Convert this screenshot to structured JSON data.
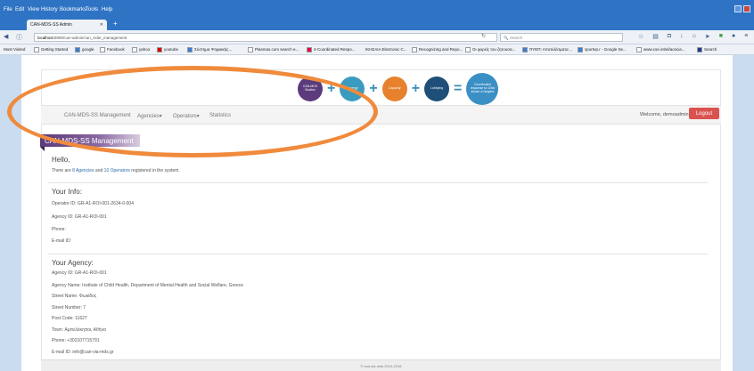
{
  "browser": {
    "menu": [
      "File",
      "Edit",
      "View",
      "History",
      "Bookmarks",
      "Tools",
      "Help"
    ],
    "tab_title": "CAN-MDS-SS Admin",
    "new_tab": "+",
    "url_host": "localhost",
    "url_path": ":8080/can-admin/can_ssite_management",
    "search_placeholder": "Search",
    "bookmarks": [
      "Most Visited",
      "Getting Started",
      "google",
      "Facebook",
      "yahoo",
      "youtube",
      "Σύστημα Ψηφιακής...",
      "Plasmas.com search e...",
      "4-Coordinated Respo...",
      "ΙΚΗΣΑΙΑ Electronic C...",
      "Recognizing and Repo...",
      "Οι φορείς του ζητουσα...",
      "ΠΥΕΠ: Αποτελέσματα ...",
      "sportep.r - Google Se...",
      "www.cse.int/el/acecia...",
      "Search"
    ]
  },
  "app": {
    "logos": [
      {
        "label": "CAN-MDS Studies",
        "color": "#5b3b7b"
      },
      {
        "label": "Synergy",
        "color": "#3a9bbf"
      },
      {
        "label": "Capacity",
        "color": "#e7812d"
      },
      {
        "label": "Lobbying",
        "color": "#1f4e79"
      },
      {
        "label": "Coordinated response to Child Abuse & Neglect",
        "color": "#3a8fc5"
      }
    ],
    "nav": {
      "brand": "CAN-MDS-SS Management",
      "agencies": "Agencies▾",
      "operators": "Operators▾",
      "statistics": "Statistics",
      "welcome": "Welcome, demoadmin",
      "logout": "Logout"
    },
    "banner": "CAN-MDS-SS Management",
    "hello": {
      "title": "Hello,",
      "text_pre": "There are ",
      "agencies_link": "8 Agencies",
      "text_mid": " and ",
      "operators_link": "10 Operators",
      "text_post": " registered in the system."
    },
    "your_info": {
      "title": "Your Info:",
      "operator_id": "Operator ID: GR-A1-ROI-001-2634-0-004",
      "agency_id": "Agency ID: GR-A1-ROI-001",
      "phone": "Phone:",
      "email": "E-mail ID:"
    },
    "your_agency": {
      "title": "Your Agency:",
      "agency_id": "Agency ID: GR-A1-ROI-001",
      "agency_name": "Agency Name: Institute of Child Health, Department of Mental Health and Social Welfare, Greece",
      "street_name": "Street Name: Φωκίδος",
      "street_number": "Street Number: 7",
      "post_code": "Post Code: 11627",
      "town": "Town: Αμπελόκηποι, Αθήνα",
      "phone": "Phone: +302107715791",
      "email": "E-mail ID: info@can-via-mds.gr"
    },
    "footer": "© can-via-mds 2014-2016"
  },
  "colors": {
    "browser_blue": "#2f74c4",
    "logout_red": "#d9534f",
    "annotation_orange": "#f08a3c",
    "banner_purple": "#5a3a78"
  }
}
